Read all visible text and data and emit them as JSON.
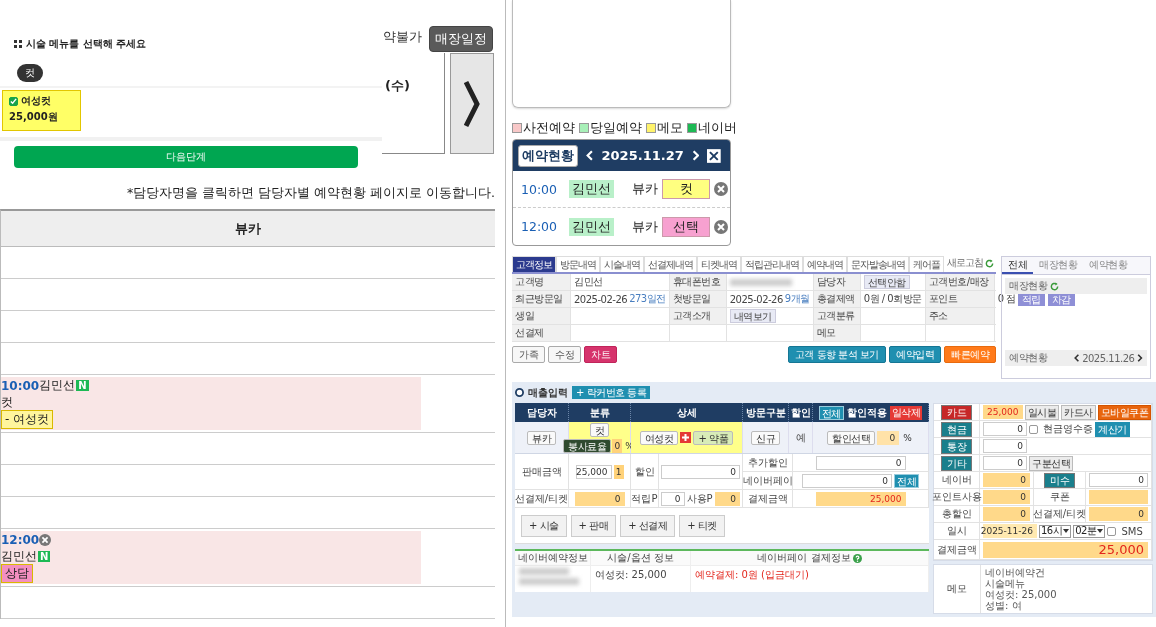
{
  "menu_popup": {
    "title": "시술 메뉴를 선택해 주세요",
    "categories": [
      {
        "label": "컷",
        "selected": true
      }
    ],
    "items": [
      {
        "name": "여성컷",
        "price": "25,000원",
        "checked": true
      }
    ],
    "next_button": "다음단계"
  },
  "schedule": {
    "unavailable_label": "약불가",
    "store_schedule_button": "매장일정",
    "date_label": "(수)",
    "notice": "*담당자명을 클릭하면 담당자별 예약현황 페이지로 이동합니다.",
    "staff_column": "뷰카",
    "slots": [
      {
        "kind": "empty"
      },
      {
        "kind": "empty"
      },
      {
        "kind": "empty"
      },
      {
        "kind": "empty"
      },
      {
        "kind": "booking",
        "time": "10:00",
        "cancel": false,
        "name": "김민선",
        "badge": "N",
        "service": "컷",
        "item": "- 여성컷",
        "color": "#fff59d"
      },
      {
        "kind": "empty"
      },
      {
        "kind": "empty"
      },
      {
        "kind": "empty"
      },
      {
        "kind": "booking",
        "time": "12:00",
        "cancel": true,
        "name": "김민선",
        "badge": "N",
        "item": "상담",
        "color": "#f48fc0"
      },
      {
        "kind": "empty"
      }
    ]
  },
  "legend": [
    {
      "label": "사전예약",
      "color": "#f8c8c8"
    },
    {
      "label": "당일예약",
      "color": "#a8f0b8"
    },
    {
      "label": "메모",
      "color": "#fff36b"
    },
    {
      "label": "네이버",
      "color": "#1db954"
    }
  ],
  "reservations": {
    "title": "예약현황",
    "date": "2025.11.27",
    "rows": [
      {
        "time": "10:00",
        "name": "김민선",
        "staff": "뷰카",
        "service": "컷",
        "color": "#ffff80"
      },
      {
        "time": "12:00",
        "name": "김민선",
        "staff": "뷰카",
        "service": "선택",
        "color": "#f7a1d0"
      }
    ]
  },
  "customer": {
    "tabs": [
      {
        "label": "고객정보",
        "selected": true
      },
      {
        "label": "방문내역",
        "selected": false
      },
      {
        "label": "시술내역",
        "selected": false
      },
      {
        "label": "선결제내역",
        "selected": false
      },
      {
        "label": "티켓내역",
        "selected": false
      },
      {
        "label": "적립관리내역",
        "selected": false
      },
      {
        "label": "예약내역",
        "selected": false
      },
      {
        "label": "문자발송내역",
        "selected": false
      },
      {
        "label": "케어플",
        "selected": false
      }
    ],
    "refresh": "새로고침",
    "info_rows": [
      [
        {
          "kind": "label",
          "text": "고객명"
        },
        {
          "kind": "value",
          "text": "김민선"
        },
        {
          "kind": "label",
          "text": "휴대폰번호"
        },
        {
          "kind": "blurred"
        },
        {
          "kind": "label",
          "text": "담당자"
        },
        {
          "kind": "button",
          "text": "선택안함"
        },
        {
          "kind": "label",
          "text": "고객번호/매장"
        },
        {
          "kind": "empty"
        }
      ],
      [
        {
          "kind": "label",
          "text": "최근방문일"
        },
        {
          "kind": "value",
          "text": "2025-02-26",
          "note": "273일전"
        },
        {
          "kind": "label",
          "text": "첫방문일"
        },
        {
          "kind": "value",
          "text": "2025-02-26",
          "note": "9개월"
        },
        {
          "kind": "label",
          "text": "총결제액"
        },
        {
          "kind": "value",
          "text": "0원 / 0회방문"
        },
        {
          "kind": "label",
          "text": "포인트"
        },
        {
          "kind": "points",
          "text": "0 점",
          "buttons": [
            "적립",
            "차감"
          ]
        }
      ],
      [
        {
          "kind": "label",
          "text": "생일"
        },
        {
          "kind": "empty"
        },
        {
          "kind": "label",
          "text": "고객소개"
        },
        {
          "kind": "button",
          "text": "내역보기"
        },
        {
          "kind": "label",
          "text": "고객분류"
        },
        {
          "kind": "empty"
        },
        {
          "kind": "label",
          "text": "주소"
        },
        {
          "kind": "empty"
        }
      ],
      [
        {
          "kind": "label",
          "text": "선결제"
        },
        {
          "kind": "empty"
        },
        {
          "kind": "empty"
        },
        {
          "kind": "empty"
        },
        {
          "kind": "label",
          "text": "메모"
        },
        {
          "kind": "empty"
        },
        {
          "kind": "empty"
        },
        {
          "kind": "empty"
        }
      ]
    ],
    "left_buttons": [
      {
        "label": "가족",
        "kind": "plain"
      },
      {
        "label": "수정",
        "kind": "plain"
      },
      {
        "label": "차트",
        "kind": "pink"
      }
    ],
    "right_buttons": [
      {
        "label": "고객 동향 분석 보기",
        "kind": "teal"
      },
      {
        "label": "예약입력",
        "kind": "teal"
      },
      {
        "label": "빠른예약",
        "kind": "orange"
      }
    ]
  },
  "side_panel": {
    "tabs": [
      {
        "label": "전체",
        "selected": true
      },
      {
        "label": "매장현황",
        "selected": false
      },
      {
        "label": "예약현황",
        "selected": false
      }
    ],
    "store_status": "매장현황",
    "reservation_status": "예약현황",
    "date": "2025.11.26"
  },
  "sales": {
    "title": "매출입력",
    "locker_button": "+ 락커번호 등록",
    "headers": [
      "담당자",
      "분류",
      "상세",
      "방문구분",
      "할인"
    ],
    "discount_all_button": "전체",
    "discount_apply": "할인적용",
    "delete_button": "일삭제",
    "staff_button": "뷰카",
    "category_button": "컷",
    "service_fee_button": "봉사료율",
    "service_fee": "0",
    "percent": "%",
    "detail_button": "여성컷",
    "medicine_button": "+ 약품",
    "visit_button": "신규",
    "discount_flag": "예",
    "discount_select": "할인선택",
    "discount_rate": "0",
    "discount_percent": "%",
    "sale_label": "판매금액",
    "sale_amount": "25,000",
    "quantity": "1",
    "discount_label": "할인",
    "discount": "0",
    "extra_discount_label": "추가할인",
    "extra_discount": "0",
    "naverpay_label": "네이버페이",
    "naverpay": "0",
    "naverpay_all_button": "전체",
    "prepaid_label": "선결제/티켓",
    "prepaid": "0",
    "earn_label": "적립P",
    "earn": "0",
    "use_label": "사용P",
    "use": "0",
    "total_label": "결제금액",
    "total": "25,000",
    "add_buttons": [
      "+ 시술",
      "+ 판매",
      "+ 선결제",
      "+ 티켓"
    ],
    "naver_headers": [
      "네이버예약정보",
      "시술/옵션 정보",
      "네이버페이 결제정보"
    ],
    "naver_option": "여성컷: 25,000",
    "naver_payment": "예약결제: 0원 (입금대기)"
  },
  "payment": {
    "methods": [
      {
        "label": "카드",
        "kind": "card",
        "amount": "25,000",
        "buttons": [
          "일시불",
          "카드사",
          "모바일쿠폰"
        ]
      },
      {
        "label": "현금",
        "kind": "account",
        "amount": "0",
        "checkbox": {
          "label": "현금영수증",
          "checked": false
        },
        "buttons": [
          "계산기"
        ]
      },
      {
        "label": "통장",
        "kind": "account",
        "amount": "0"
      },
      {
        "label": "기타",
        "kind": "account",
        "amount": "0",
        "buttons": [
          "구분선택"
        ]
      }
    ],
    "pairs": [
      [
        {
          "label": "네이버",
          "value": "0",
          "kind": "plain"
        },
        {
          "label": "미수",
          "value": "0",
          "kind": "button"
        }
      ],
      [
        {
          "label": "포인트사용",
          "value": "0",
          "kind": "plain"
        },
        {
          "label": "쿠폰",
          "kind": "plain"
        }
      ],
      [
        {
          "label": "총할인",
          "value": "0",
          "kind": "plain"
        },
        {
          "label": "선결제/티켓",
          "value": "0",
          "kind": "plain"
        }
      ]
    ],
    "date_label": "일시",
    "date": "2025-11-26",
    "hour": "16시",
    "minute": "02분",
    "sms": {
      "label": "SMS",
      "checked": false
    },
    "total_label": "결제금액",
    "total": "25,000",
    "memo_label": "메모",
    "memo_lines": [
      "네이버예약건",
      "시술메뉴",
      "여성컷: 25,000",
      "성별: 여"
    ]
  }
}
